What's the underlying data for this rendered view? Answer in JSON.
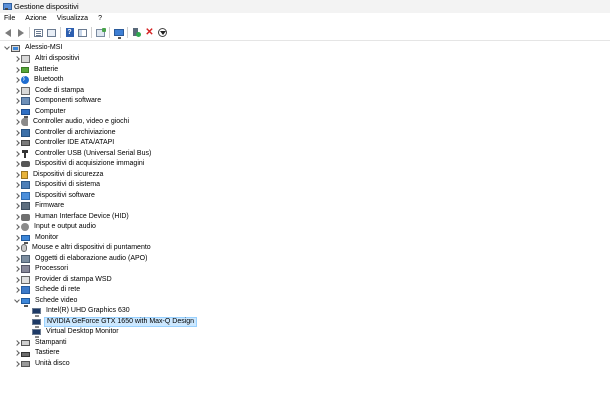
{
  "window": {
    "title": "Gestione dispositivi"
  },
  "menu": [
    "File",
    "Azione",
    "Visualizza",
    "?"
  ],
  "toolbar": {
    "buttons": [
      "back-arrow-icon",
      "forward-arrow-icon",
      "properties-icon",
      "list-view-icon",
      "help-icon",
      "panel-icon",
      "scan-hardware-icon",
      "monitor-icon",
      "update-driver-icon",
      "uninstall-icon",
      "disable-device-icon"
    ]
  },
  "tree": {
    "root": "Alessio-MSI",
    "categories": [
      {
        "label": "Altri dispositivi",
        "icon": "unknown-device-icon"
      },
      {
        "label": "Batterie",
        "icon": "battery-icon"
      },
      {
        "label": "Bluetooth",
        "icon": "bluetooth-icon"
      },
      {
        "label": "Code di stampa",
        "icon": "print-queue-icon"
      },
      {
        "label": "Componenti software",
        "icon": "software-component-icon"
      },
      {
        "label": "Computer",
        "icon": "computer-icon"
      },
      {
        "label": "Controller audio, video e giochi",
        "icon": "speaker-icon"
      },
      {
        "label": "Controller di archiviazione",
        "icon": "storage-controller-icon"
      },
      {
        "label": "Controller IDE ATA/ATAPI",
        "icon": "ide-controller-icon"
      },
      {
        "label": "Controller USB (Universal Serial Bus)",
        "icon": "usb-icon"
      },
      {
        "label": "Dispositivi di acquisizione immagini",
        "icon": "camera-icon"
      },
      {
        "label": "Dispositivi di sicurezza",
        "icon": "security-device-icon"
      },
      {
        "label": "Dispositivi di sistema",
        "icon": "system-device-icon"
      },
      {
        "label": "Dispositivi software",
        "icon": "software-device-icon"
      },
      {
        "label": "Firmware",
        "icon": "firmware-icon"
      },
      {
        "label": "Human Interface Device (HID)",
        "icon": "hid-icon"
      },
      {
        "label": "Input e output audio",
        "icon": "audio-io-icon"
      },
      {
        "label": "Monitor",
        "icon": "monitor-icon"
      },
      {
        "label": "Mouse e altri dispositivi di puntamento",
        "icon": "mouse-icon"
      },
      {
        "label": "Oggetti di elaborazione audio (APO)",
        "icon": "audio-processing-icon"
      },
      {
        "label": "Processori",
        "icon": "processor-icon"
      },
      {
        "label": "Provider di stampa WSD",
        "icon": "wsd-print-provider-icon"
      },
      {
        "label": "Schede di rete",
        "icon": "network-adapter-icon"
      }
    ],
    "expanded": {
      "label": "Schede video",
      "icon": "display-adapter-icon",
      "children": [
        {
          "label": "Intel(R) UHD Graphics 630",
          "icon": "display-adapter-icon"
        },
        {
          "label": "NVIDIA GeForce GTX 1650 with Max-Q Design",
          "icon": "display-adapter-icon",
          "selected": true
        },
        {
          "label": "Virtual Desktop Monitor",
          "icon": "display-adapter-icon"
        }
      ]
    },
    "after": [
      {
        "label": "Stampanti",
        "icon": "printer-icon"
      },
      {
        "label": "Tastiere",
        "icon": "keyboard-icon"
      },
      {
        "label": "Unità disco",
        "icon": "disk-drive-icon"
      }
    ]
  }
}
